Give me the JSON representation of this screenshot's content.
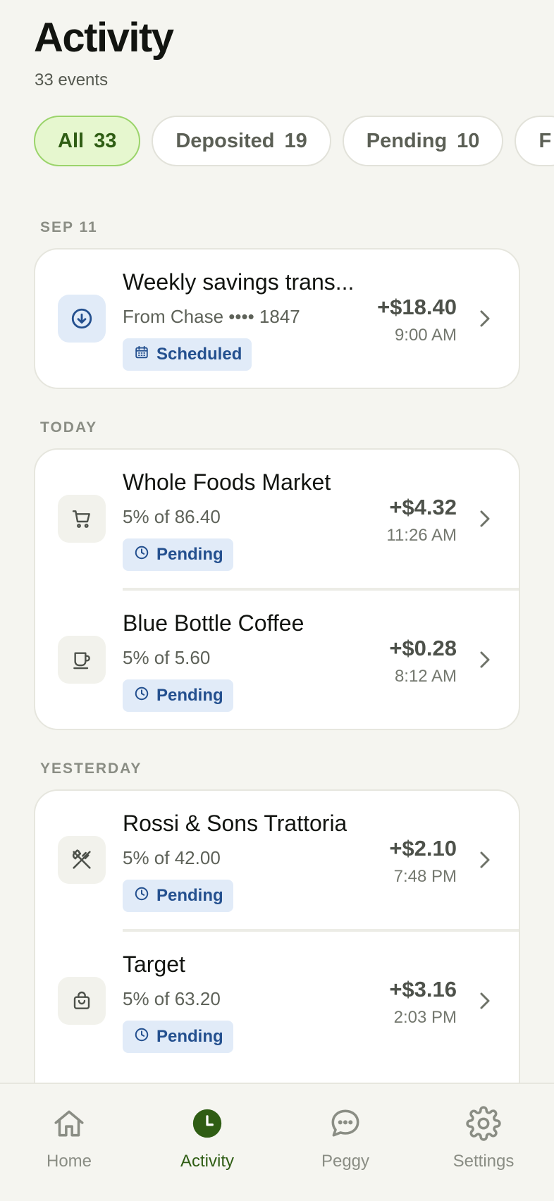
{
  "header": {
    "title": "Activity",
    "subtitle": "33 events"
  },
  "filters": [
    {
      "label": "All",
      "count": "33",
      "active": true
    },
    {
      "label": "Deposited",
      "count": "19",
      "active": false
    },
    {
      "label": "Pending",
      "count": "10",
      "active": false
    },
    {
      "label": "F",
      "count": "",
      "active": false
    }
  ],
  "sections": [
    {
      "label": "SEP 11",
      "items": [
        {
          "title": "Weekly savings trans...",
          "subtitle": "From Chase •••• 1847",
          "badge": "Scheduled",
          "badge_icon": "calendar-icon",
          "amount": "+$18.40",
          "time": "9:00 AM",
          "icon": "download-circle-icon"
        }
      ]
    },
    {
      "label": "TODAY",
      "items": [
        {
          "title": "Whole Foods Market",
          "subtitle": "5% of 86.40",
          "badge": "Pending",
          "badge_icon": "clock-icon",
          "amount": "+$4.32",
          "time": "11:26 AM",
          "icon": "cart-icon"
        },
        {
          "title": "Blue Bottle Coffee",
          "subtitle": "5% of 5.60",
          "badge": "Pending",
          "badge_icon": "clock-icon",
          "amount": "+$0.28",
          "time": "8:12 AM",
          "icon": "coffee-cup-icon"
        }
      ]
    },
    {
      "label": "YESTERDAY",
      "items": [
        {
          "title": "Rossi & Sons Trattoria",
          "subtitle": "5% of 42.00",
          "badge": "Pending",
          "badge_icon": "clock-icon",
          "amount": "+$2.10",
          "time": "7:48 PM",
          "icon": "utensils-icon"
        },
        {
          "title": "Target",
          "subtitle": "5% of 63.20",
          "badge": "Pending",
          "badge_icon": "clock-icon",
          "amount": "+$3.16",
          "time": "2:03 PM",
          "icon": "shopping-bag-icon"
        }
      ]
    }
  ],
  "tabbar": [
    {
      "label": "Home",
      "icon": "home-icon",
      "active": false
    },
    {
      "label": "Activity",
      "icon": "clock-filled-icon",
      "active": true
    },
    {
      "label": "Peggy",
      "icon": "chat-bubble-icon",
      "active": false
    },
    {
      "label": "Settings",
      "icon": "gear-icon",
      "active": false
    }
  ],
  "colors": {
    "accent_green": "#2f5d14",
    "chip_active_bg": "#e6f7cf",
    "badge_blue": "#24508f",
    "badge_bg": "#e1ebf8",
    "background": "#f5f5f0"
  }
}
